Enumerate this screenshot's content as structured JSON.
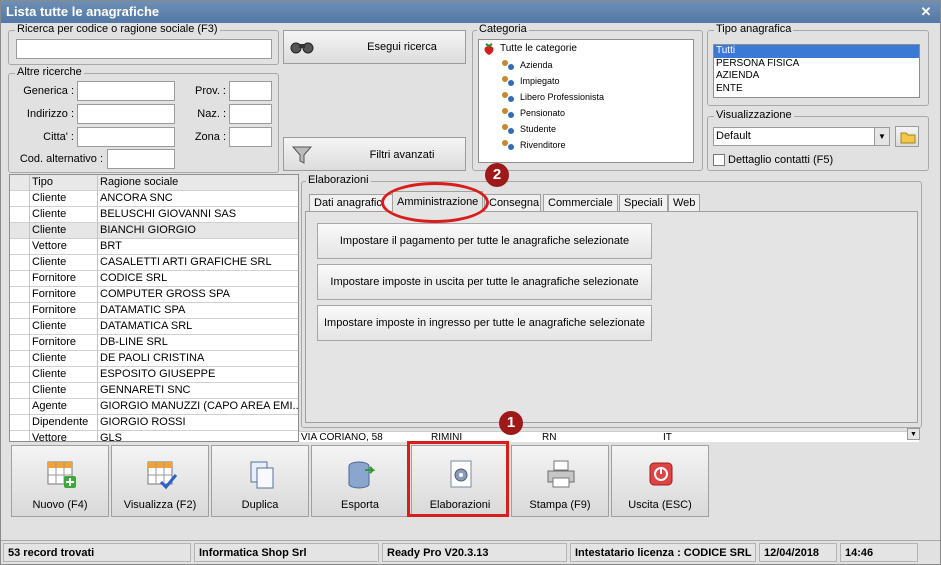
{
  "window": {
    "title": "Lista tutte le anagrafiche"
  },
  "search": {
    "group_label": "Ricerca per codice o ragione sociale (F3)",
    "value": "",
    "button_label": "Esegui ricerca"
  },
  "other_search": {
    "group_label": "Altre ricerche",
    "generica": "Generica :",
    "indirizzo": "Indirizzo :",
    "citta": "Citta' :",
    "cod_alt": "Cod. alternativo :",
    "prov": "Prov. :",
    "naz": "Naz. :",
    "zona": "Zona :"
  },
  "filters": {
    "button_label": "Filtri avanzati"
  },
  "categoria": {
    "group_label": "Categoria",
    "items": [
      "Tutte le categorie",
      "Azienda",
      "Impiegato",
      "Libero Professionista",
      "Pensionato",
      "Studente",
      "Rivenditore"
    ]
  },
  "tipo": {
    "group_label": "Tipo anagrafica",
    "items": [
      "Tutti",
      "PERSONA FISICA",
      "AZIENDA",
      "ENTE"
    ]
  },
  "visual": {
    "group_label": "Visualizzazione",
    "selected": "Default",
    "dettaglio_label": "Dettaglio contatti (F5)"
  },
  "grid": {
    "headers": [
      "Tipo",
      "Ragione sociale"
    ],
    "rows": [
      [
        "Cliente",
        "ANCORA SNC"
      ],
      [
        "Cliente",
        "BELUSCHI GIOVANNI SAS"
      ],
      [
        "Cliente",
        "BIANCHI GIORGIO"
      ],
      [
        "Vettore",
        "BRT"
      ],
      [
        "Cliente",
        "CASALETTI ARTI GRAFICHE SRL"
      ],
      [
        "Fornitore",
        "CODICE SRL"
      ],
      [
        "Fornitore",
        "COMPUTER GROSS SPA"
      ],
      [
        "Fornitore",
        "DATAMATIC SPA"
      ],
      [
        "Cliente",
        "DATAMATICA SRL"
      ],
      [
        "Fornitore",
        "DB-LINE SRL"
      ],
      [
        "Cliente",
        "DE PAOLI CRISTINA"
      ],
      [
        "Cliente",
        "ESPOSITO GIUSEPPE"
      ],
      [
        "Cliente",
        "GENNARETI SNC"
      ],
      [
        "Agente",
        "GIORGIO MANUZZI (CAPO AREA EMI..."
      ],
      [
        "Dipendente",
        "GIORGIO ROSSI"
      ],
      [
        "Vettore",
        "GLS"
      ]
    ],
    "partial": [
      "VIA CORIANO, 58",
      "RIMINI",
      "RN",
      "IT"
    ]
  },
  "elaborazioni": {
    "group_label": "Elaborazioni",
    "tabs": [
      "Dati anagrafici",
      "Amministrazione",
      "Consegna",
      "Commerciale",
      "Speciali",
      "Web"
    ],
    "buttons": [
      "Impostare il pagamento per tutte le anagrafiche selezionate",
      "Impostare imposte in uscita per tutte le anagrafiche selezionate",
      "Impostare imposte in ingresso per tutte le anagrafiche selezionate"
    ]
  },
  "toolbar": [
    "Nuovo (F4)",
    "Visualizza (F2)",
    "Duplica",
    "Esporta",
    "Elaborazioni",
    "Stampa (F9)",
    "Uscita (ESC)"
  ],
  "annotations": [
    "1",
    "2"
  ],
  "status": {
    "records": "53 record trovati",
    "company": "Informatica Shop Srl",
    "version": "Ready Pro V20.3.13",
    "licence": "Intestatario licenza : CODICE SRL",
    "date": "12/04/2018",
    "time": "14:46"
  }
}
